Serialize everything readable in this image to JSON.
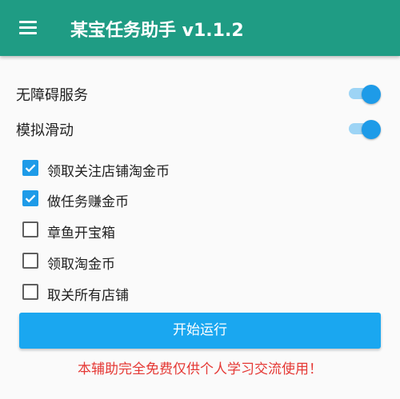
{
  "toolbar": {
    "title": "某宝任务助手 v1.1.2",
    "menu_icon": "hamburger-menu-icon",
    "color": "#1f9c84"
  },
  "switches": [
    {
      "label": "无障碍服务",
      "on": true
    },
    {
      "label": "模拟滑动",
      "on": true
    }
  ],
  "checkboxes": [
    {
      "label": "领取关注店铺淘金币",
      "checked": true
    },
    {
      "label": "做任务赚金币",
      "checked": true
    },
    {
      "label": "章鱼开宝箱",
      "checked": false
    },
    {
      "label": "领取淘金币",
      "checked": false
    },
    {
      "label": "取关所有店铺",
      "checked": false
    }
  ],
  "start_button": {
    "label": "开始运行",
    "color": "#1aa7f0"
  },
  "notice": {
    "text": "本辅助完全免费仅供个人学习交流使用！",
    "color": "#e53935"
  }
}
